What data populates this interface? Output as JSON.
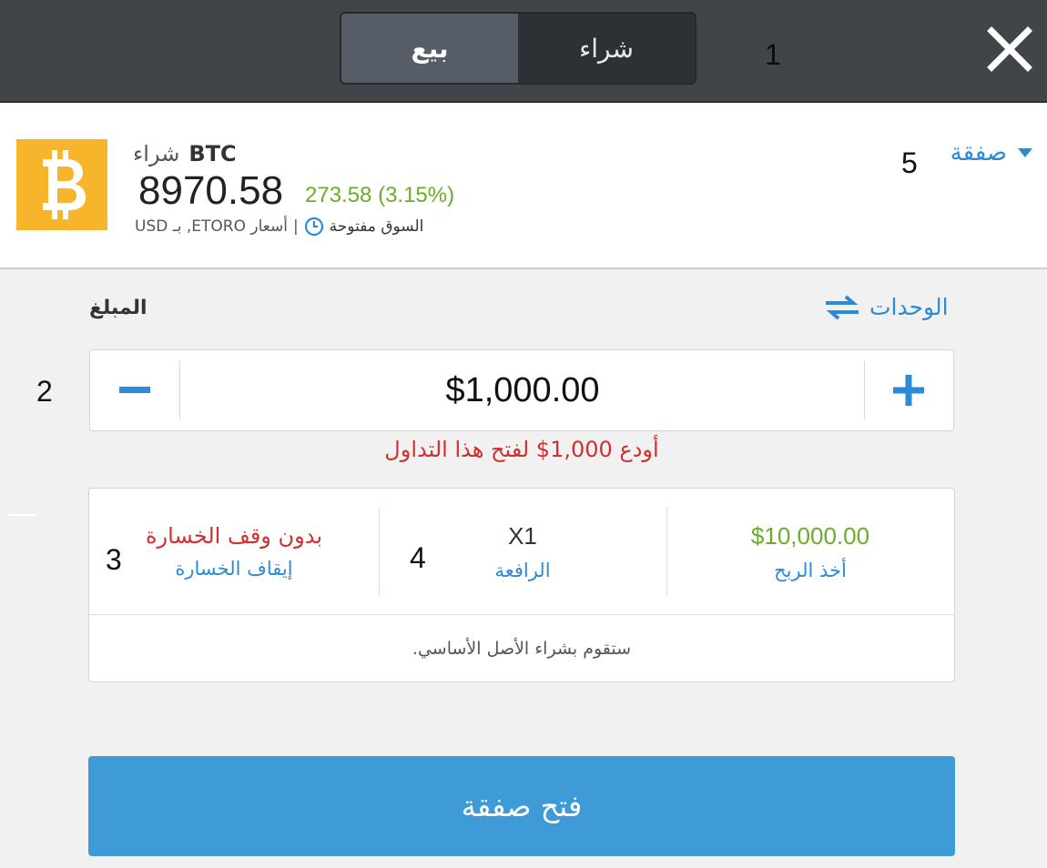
{
  "header": {
    "sell_label": "بيع",
    "buy_label": "شراء",
    "marker_1": "1"
  },
  "instrument": {
    "symbol": "BTC",
    "action": "شراء",
    "price": "8970.58",
    "change": "273.58  (3.15%)",
    "market_status": "السوق مفتوحة",
    "pricing_info": "USD بـ ,ETORO أسعار",
    "separator": "|",
    "logo_icon": "bitcoin-icon",
    "trade_dropdown_label": "صفقة",
    "marker_5": "5"
  },
  "amount": {
    "units_label": "الوحدات",
    "amount_label": "المبلغ",
    "value": "$1,000.00",
    "marker_2": "2",
    "deposit_message": "أودع 1,000$ لفتح هذا التداول"
  },
  "settings": {
    "take_profit_value": "$10,000.00",
    "take_profit_label": "أخذ الربح",
    "leverage_value": "X1",
    "leverage_label": "الرافعة",
    "stop_loss_value": "بدون وقف الخسارة",
    "stop_loss_label": "إيقاف الخسارة",
    "marker_3": "3",
    "marker_4": "4",
    "note": ".ستقوم بشراء الأصل الأساسي"
  },
  "open_trade_label": "فتح صفقة",
  "colors": {
    "accent": "#2b8bd6",
    "positive": "#6aac2c",
    "negative": "#d32f2f",
    "button": "#3f9ad8",
    "bitcoin": "#f7b52c"
  }
}
